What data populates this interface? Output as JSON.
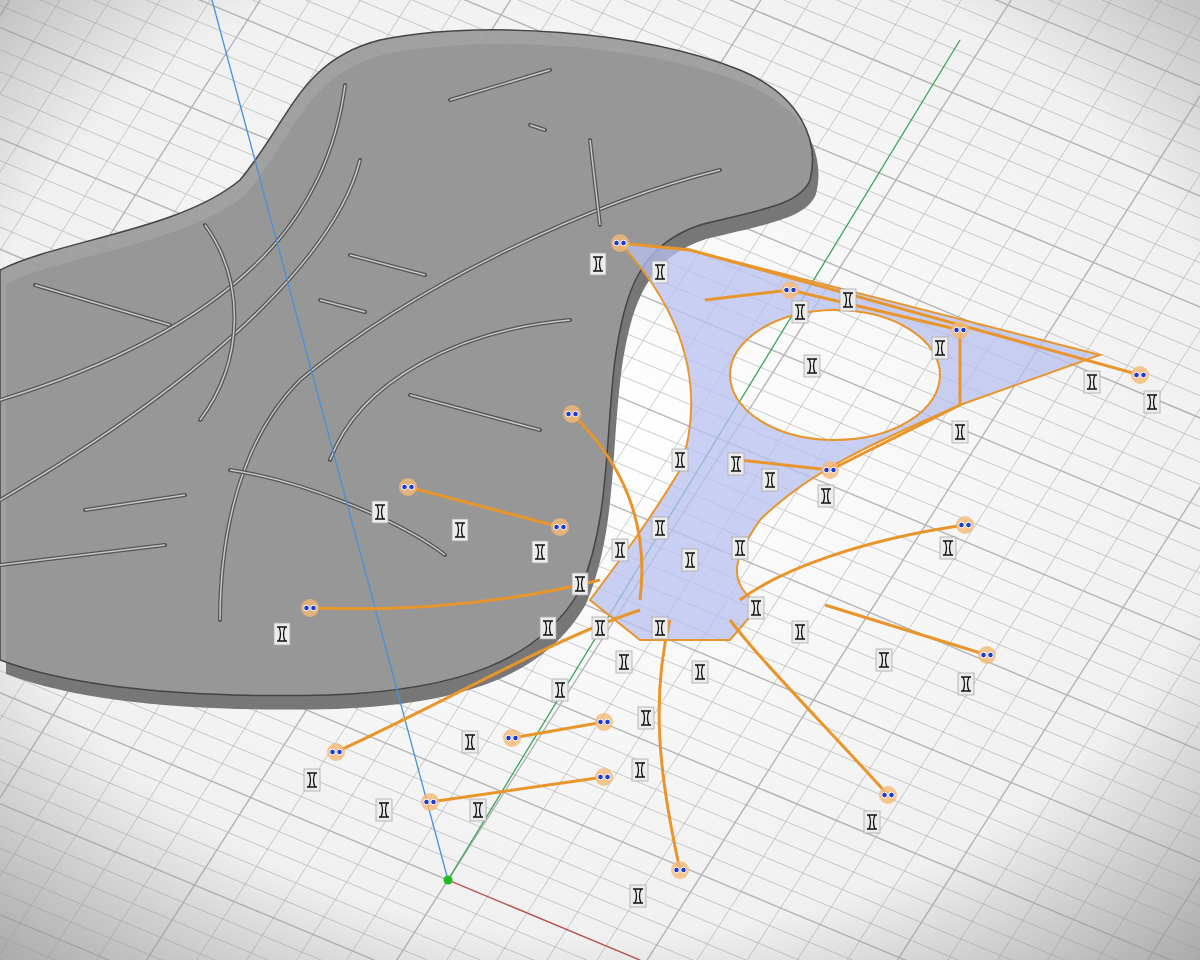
{
  "viewport": {
    "grid": true,
    "axes": [
      {
        "kind": "x",
        "color": "#c0504d"
      },
      {
        "kind": "y",
        "color": "#3aa655"
      },
      {
        "kind": "z",
        "color": "#4a90d9"
      }
    ],
    "origin": {
      "color": "#22bb22"
    }
  },
  "sketch": {
    "profile_selected": true
  }
}
